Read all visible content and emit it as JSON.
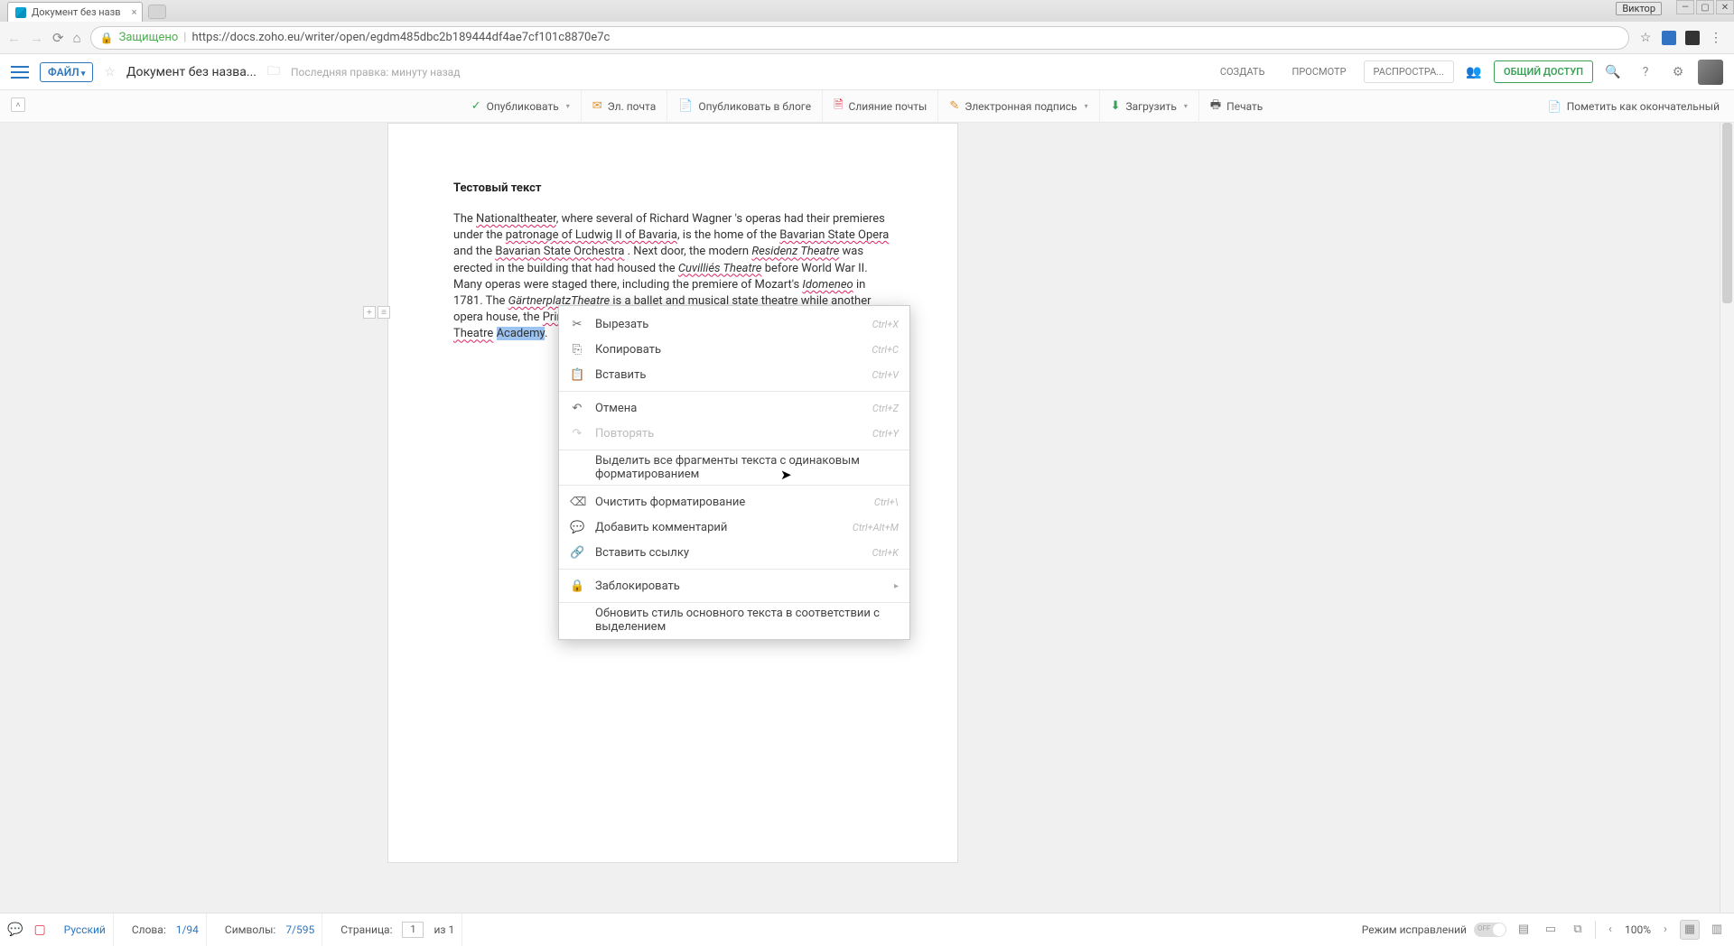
{
  "browser": {
    "tab_title": "Документ без назв",
    "user_chip": "Виктор",
    "secure_label": "Защищено",
    "url": "https://docs.zoho.eu/writer/open/egdm485dbc2b189444df4ae7cf101c8870e7c",
    "star_glyph": "☆"
  },
  "appbar": {
    "file_btn": "ФАЙЛ",
    "doc_title": "Документ без назва...",
    "last_edit": "Последняя правка: минуту назад",
    "create": "СОЗДАТЬ",
    "preview": "ПРОСМОТР",
    "distribute": "РАСПРОСТРА...",
    "share": "ОБЩИЙ ДОСТУП"
  },
  "toolbar": {
    "publish": "Опубликовать",
    "email": "Эл. почта",
    "blog": "Опубликовать в блоге",
    "mailmerge": "Слияние почты",
    "esign": "Электронная подпись",
    "download": "Загрузить",
    "print": "Печать",
    "mark_final": "Пометить как окончательный"
  },
  "document": {
    "heading": "Тестовый текст",
    "body_html": "The <span class='spellw'>Nationaltheater</span>, where several of Richard Wagner 's operas had their premieres under the <span class='spellw'>patronage of Ludwig II of Bavaria</span>, is the home of the <span class='spellw'>Bavarian State Opera</span> and the <span class='spellw'>Bavarian State Orchestra</span> . Next door, the modern <span class='italic spellw'>Residenz Theatre</span> was erected in the building that had housed the <span class='italic spellw'>Cuvilliés Theatre</span> before World War II. Many operas were staged there, including the premiere of Mozart's <span class='italic spellw'>Idomeneo</span> in 1781. The <span class='italic spellw'>GärtnerplatzTheatre</span> is a ballet and musical state theatre while another opera house, the <span class='spellw'>Prinzregententheater</span>, has become the home of the <span class='spellw'>Bavarian Theatre</span> <span class='sel'>Academy</span>."
  },
  "context_menu": {
    "cut": "Вырезать",
    "cut_sc": "Ctrl+X",
    "copy": "Копировать",
    "copy_sc": "Ctrl+C",
    "paste": "Вставить",
    "paste_sc": "Ctrl+V",
    "undo": "Отмена",
    "undo_sc": "Ctrl+Z",
    "redo": "Повторять",
    "redo_sc": "Ctrl+Y",
    "select_same": "Выделить все фрагменты текста с одинаковым форматированием",
    "clear_fmt": "Очистить форматирование",
    "clear_fmt_sc": "Ctrl+\\",
    "add_comment": "Добавить комментарий",
    "add_comment_sc": "Ctrl+Alt+M",
    "insert_link": "Вставить ссылку",
    "insert_link_sc": "Ctrl+K",
    "lock": "Заблокировать",
    "update_style": "Обновить стиль основного текста в соответствии с выделением"
  },
  "statusbar": {
    "lang": "Русский",
    "words_lbl": "Слова:",
    "words_val": "1/94",
    "chars_lbl": "Символы:",
    "chars_val": "7/595",
    "page_lbl": "Страница:",
    "page_val": "1",
    "page_of": "из 1",
    "track_lbl": "Режим исправлений",
    "track_state": "OFF",
    "zoom": "100%"
  }
}
